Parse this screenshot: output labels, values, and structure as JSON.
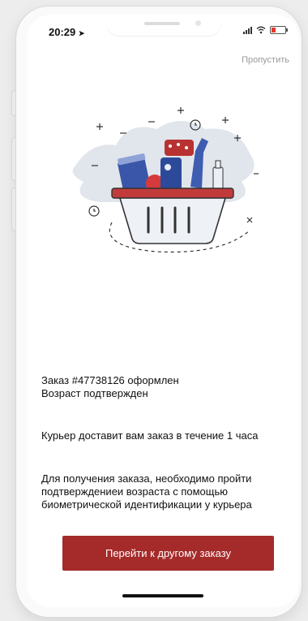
{
  "status_bar": {
    "time": "20:29"
  },
  "header": {
    "skip_label": "Пропустить"
  },
  "order": {
    "title": "Заказ #47738126 оформлен",
    "age_status": "Возраст подтвержден",
    "delivery_info": "Курьер доставит вам заказ в течение 1 часа",
    "biometric_note": "Для получения заказа, необходимо пройти подтверждениеи возраста с помощью биометрической идентификации у курьера"
  },
  "cta": {
    "label": "Перейти к другому заказу"
  },
  "colors": {
    "accent": "#a52a2a",
    "basket": "#c23b3b",
    "illustration_bg": "#dfe3ea"
  }
}
